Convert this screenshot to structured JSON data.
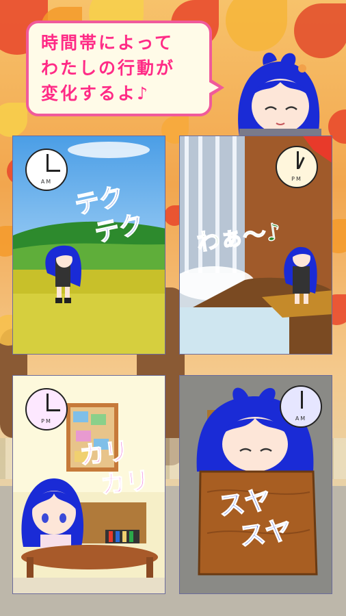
{
  "bubble": {
    "lines": [
      "時間帯によって",
      "わたしの行動が",
      "変化するよ♪"
    ]
  },
  "panels": [
    {
      "id": "walking",
      "clock_period": "AM",
      "clock_face": "#ffffff",
      "sfx_lines": [
        "テク",
        "テク"
      ],
      "sfx_color": "#1d55c8"
    },
    {
      "id": "waterfall",
      "clock_period": "PM",
      "clock_face": "#fff6dc",
      "sfx_lines": [
        "わぁ〜♪"
      ],
      "sfx_color": "#2a8a2a"
    },
    {
      "id": "studying",
      "clock_period": "PM",
      "clock_face": "#fde8ff",
      "sfx_lines": [
        "カリ",
        "カリ"
      ],
      "sfx_color": "#e83ac9"
    },
    {
      "id": "sleeping",
      "clock_period": "AM",
      "clock_face": "#e6e6ff",
      "sfx_lines": [
        "スヤ",
        "スヤ"
      ],
      "sfx_color": "#2a4ad8"
    }
  ],
  "colors": {
    "bubble_border": "#f05a9b",
    "bubble_text": "#ff2a86",
    "hair": "#1a2bd6"
  }
}
